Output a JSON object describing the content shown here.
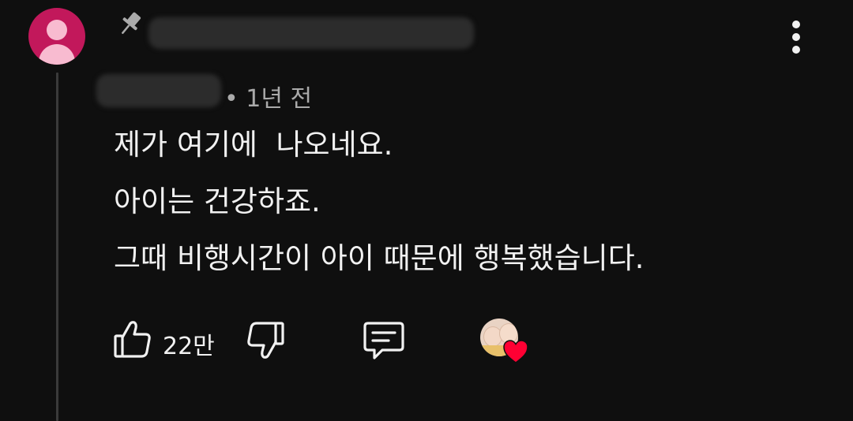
{
  "comment": {
    "timestamp": "• 1년 전",
    "lines": [
      "제가 여기에  나오네요.",
      "아이는 건강하죠.",
      "그때 비행시간이 아이 때문에 행복했습니다."
    ]
  },
  "actions": {
    "like_count": "22만"
  },
  "icons": {
    "pin": "pin-icon",
    "more": "more-vertical-icon",
    "like": "thumbs-up-icon",
    "dislike": "thumbs-down-icon",
    "reply": "reply-comment-icon",
    "heart": "heart-icon"
  },
  "colors": {
    "background": "#0f0f0f",
    "text": "#f1f1f1",
    "secondary_text": "#aaaaaa",
    "avatar": "#c2185b",
    "heart": "#ff0033"
  }
}
